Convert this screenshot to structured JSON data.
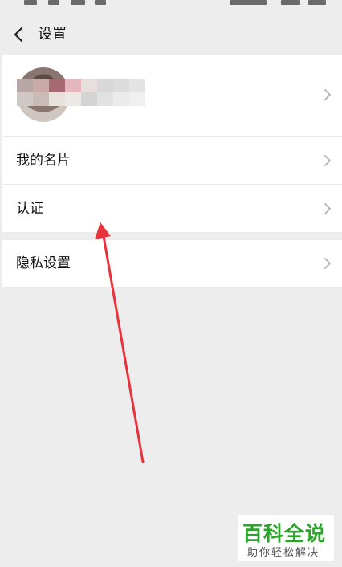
{
  "header": {
    "title": "设置",
    "back_icon": "chevron-left-icon"
  },
  "settings": {
    "profile": {
      "name_blurred": true
    },
    "items": [
      {
        "label": "我的名片"
      },
      {
        "label": "认证"
      }
    ],
    "privacy": {
      "label": "隐私设置"
    }
  },
  "watermark": {
    "main": "百科全说",
    "sub": "助你轻松解决"
  },
  "colors": {
    "background": "#ededed",
    "card": "#ffffff",
    "annotation_arrow": "#e8323c",
    "watermark_green": "#2aa52a"
  }
}
